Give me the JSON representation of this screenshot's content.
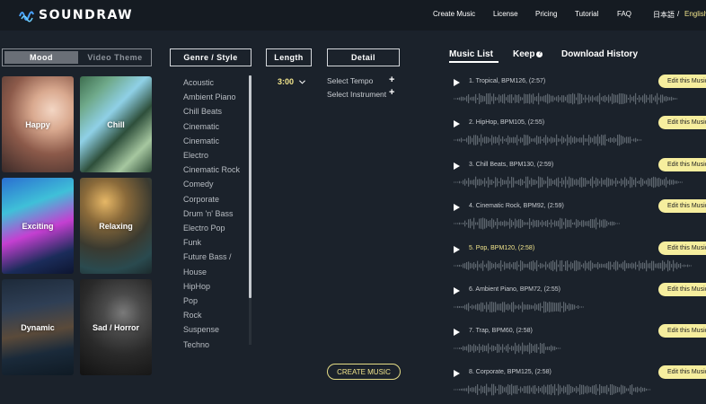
{
  "header": {
    "brand": "SOUNDRAW",
    "nav": [
      "Create Music",
      "License",
      "Pricing",
      "Tutorial",
      "FAQ"
    ],
    "lang_ja": "日本語",
    "lang_sep": "/",
    "lang_en": "English"
  },
  "left_tabs": {
    "mood": "Mood",
    "video_theme": "Video Theme"
  },
  "moods": [
    "Happy",
    "Chill",
    "Exciting",
    "Relaxing",
    "Dynamic",
    "Sad / Horror"
  ],
  "columns": {
    "genre": "Genre / Style",
    "length": "Length",
    "detail": "Detail"
  },
  "genres": [
    "Acoustic",
    "Ambient Piano",
    "Chill Beats",
    "Cinematic",
    "Cinematic",
    "Electro",
    "Cinematic Rock",
    "Comedy",
    "Corporate",
    "Drum 'n' Bass",
    "Electro Pop",
    "Funk",
    "Future Bass /",
    "House",
    "HipHop",
    "Pop",
    "Rock",
    "Suspense",
    "Techno"
  ],
  "length": {
    "value": "3:00"
  },
  "detail": {
    "tempo": "Select Tempo",
    "instrument": "Select Instrument"
  },
  "create_button": "CREATE MUSIC",
  "right_tabs": {
    "music_list": "Music List",
    "keep": "Keep",
    "download_history": "Download History"
  },
  "tracks": [
    {
      "title": "1. Tropical, BPM126, (2:57)",
      "edit": "Edit this Music"
    },
    {
      "title": "2. HipHop, BPM105, (2:55)",
      "edit": "Edit this Music"
    },
    {
      "title": "3. Chill Beats, BPM130, (2:59)",
      "edit": "Edit this Music"
    },
    {
      "title": "4. Cinematic Rock, BPM92, (2:59)",
      "edit": "Edit this Music"
    },
    {
      "title": "5. Pop, BPM120, (2:58)",
      "edit": "Edit this Music"
    },
    {
      "title": "6. Ambient Piano, BPM72, (2:55)",
      "edit": "Edit this Music"
    },
    {
      "title": "7. Trap, BPM60, (2:58)",
      "edit": "Edit this Music"
    },
    {
      "title": "8. Corporate, BPM125, (2:58)",
      "edit": "Edit this Music"
    }
  ],
  "highlighted_track": 5,
  "colors": {
    "accent": "#f2e58c",
    "background": "#1b222b",
    "edit_button": "#f6ee9e"
  }
}
